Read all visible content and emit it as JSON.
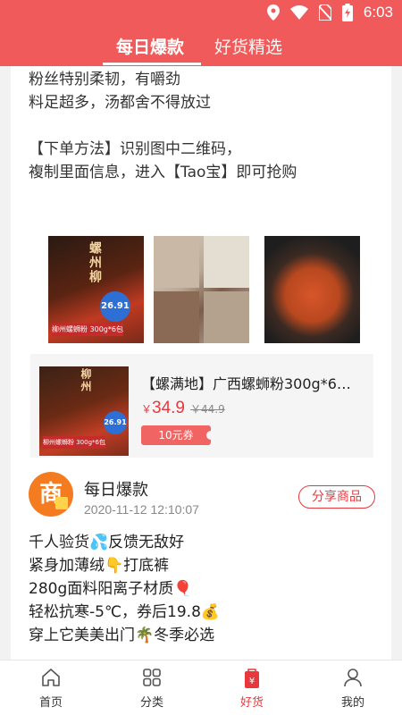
{
  "status_bar": {
    "time": "6:03"
  },
  "top_tabs": [
    {
      "label": "每日爆款"
    },
    {
      "label": "好货精选"
    }
  ],
  "post1": {
    "desc_lines": [
      "粉丝特别柔韧，有嚼劲",
      "料足超多，汤都舍不得放过",
      "",
      "【下单方法】识别图中二维码，",
      "複制里面信息，进入【Tao宝】即可抢购"
    ],
    "images": [
      {
        "title": "螺州柳",
        "badge": "26.91",
        "label": "柳州螺蛳粉 300g*6包"
      },
      {},
      {}
    ],
    "product": {
      "name": "【螺满地】广西螺蛳粉300g*6…",
      "price_symbol": "￥",
      "price": "34.9",
      "original_price": "￥44.9",
      "coupon": "10元券",
      "thumb_title": "柳州",
      "thumb_badge": "26.91",
      "thumb_label": "柳州螺蛳粉 300g*6包"
    }
  },
  "post2": {
    "author": "每日爆款",
    "avatar_char": "商",
    "time": "2020-11-12 12:10:07",
    "share_label": "分享商品",
    "lines": [
      "千人验货💦反馈无敌好",
      "紧身加薄绒👇打底裤",
      "280g面料阳离子材质🎈",
      "轻松抗寒-5℃，券后19.8💰",
      "穿上它美美出门🌴冬季必选"
    ]
  },
  "bottom_nav": [
    {
      "label": "首页",
      "icon": "home-icon"
    },
    {
      "label": "分类",
      "icon": "category-icon"
    },
    {
      "label": "好货",
      "icon": "bag-icon"
    },
    {
      "label": "我的",
      "icon": "user-icon"
    }
  ],
  "colors": {
    "brand": "#f05a5a",
    "accent": "#e8383d"
  }
}
